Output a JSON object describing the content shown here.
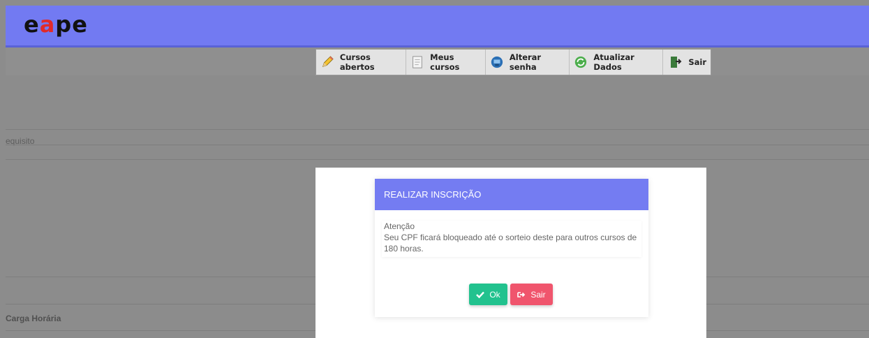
{
  "header": {
    "logo_text": "eape",
    "brand_color": "#727af2"
  },
  "menu": {
    "items": [
      {
        "label": "Cursos abertos",
        "icon": "pencil-icon"
      },
      {
        "label": "Meus cursos",
        "icon": "document-icon"
      },
      {
        "label": "Alterar senha",
        "icon": "computer-key-icon"
      },
      {
        "label": "Atualizar Dados",
        "icon": "refresh-icon"
      },
      {
        "label": "Sair",
        "icon": "exit-door-icon"
      }
    ]
  },
  "background": {
    "requisito_text": "equisito",
    "carga_horaria_text": "Carga Horária"
  },
  "modal": {
    "title": "REALIZAR INSCRIÇÃO",
    "message_title": "Atenção",
    "message_body": "Seu CPF ficará bloqueado até o sorteio deste para outros cursos de 180 horas.",
    "ok_label": "Ok",
    "cancel_label": "Sair",
    "ok_color": "#22c28e",
    "cancel_color": "#f0556d"
  }
}
